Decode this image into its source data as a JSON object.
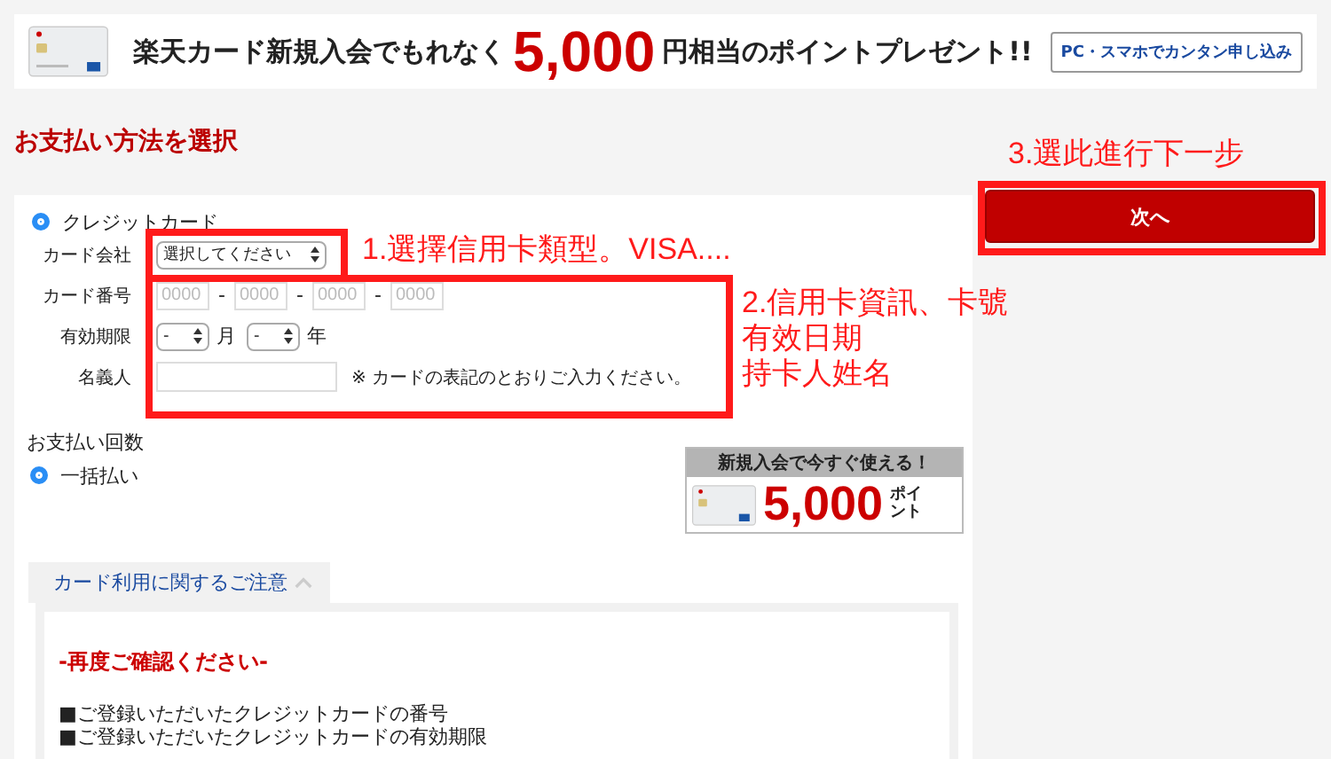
{
  "banner": {
    "lead": "楽天カード新規入会でもれなく",
    "amount": "5,000",
    "tail": "円相当のポイントプレゼント!!",
    "apply_button": "PC・スマホでカンタン申し込み"
  },
  "page_title": "お支払い方法を選択",
  "payment_method": {
    "label": "クレジットカード",
    "selected": true
  },
  "card_company": {
    "label": "カード会社",
    "value": "選択してください"
  },
  "card_number": {
    "label": "カード番号",
    "placeholders": [
      "0000",
      "0000",
      "0000",
      "0000"
    ],
    "separators": [
      "-",
      "-",
      "-"
    ]
  },
  "expiry": {
    "label": "有効期限",
    "month": "-",
    "month_unit": "月",
    "year": "-",
    "year_unit": "年"
  },
  "holder": {
    "label": "名義人",
    "note": "※ カードの表記のとおりご入力ください。"
  },
  "installments": {
    "label": "お支払い回数",
    "options": [
      {
        "label": "一括払い",
        "selected": true
      }
    ]
  },
  "promo": {
    "heading": "新規入会で今すぐ使える！",
    "amount": "5,000",
    "unit": "ポイント"
  },
  "notice": {
    "tab": "カード利用に関するご注意",
    "expanded": true,
    "heading": "-再度ご確認ください-",
    "lines": [
      "■ご登録いただいたクレジットカードの番号",
      "■ご登録いただいたクレジットカードの有効期限"
    ]
  },
  "next_button": "次へ",
  "annotations": [
    {
      "lines": [
        "1.選擇信用卡類型。VISA...."
      ]
    },
    {
      "lines": [
        "2.信用卡資訊、卡號",
        "有效日期",
        "持卡人姓名"
      ]
    },
    {
      "lines": [
        "3.選此進行下一步"
      ]
    }
  ]
}
